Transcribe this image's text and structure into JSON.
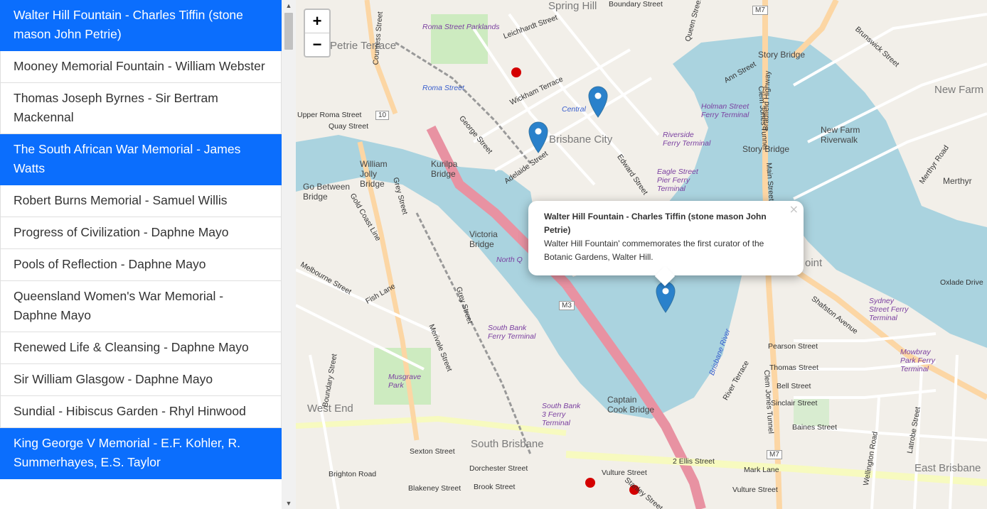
{
  "list": [
    {
      "label": "Walter Hill Fountain - Charles Tiffin (stone mason John Petrie)",
      "active": true
    },
    {
      "label": "Mooney Memorial Fountain - William Webster",
      "active": false
    },
    {
      "label": "Thomas Joseph Byrnes - Sir Bertram Mackennal",
      "active": false
    },
    {
      "label": "The South African War Memorial - James Watts",
      "active": true
    },
    {
      "label": "Robert Burns Memorial - Samuel Willis",
      "active": false
    },
    {
      "label": "Progress of Civilization - Daphne Mayo",
      "active": false
    },
    {
      "label": "Pools of Reflection - Daphne Mayo",
      "active": false
    },
    {
      "label": "Queensland Women's War Memorial - Daphne Mayo",
      "active": false
    },
    {
      "label": "Renewed Life & Cleansing - Daphne Mayo",
      "active": false
    },
    {
      "label": "Sir William Glasgow - Daphne Mayo",
      "active": false
    },
    {
      "label": "Sundial - Hibiscus Garden - Rhyl Hinwood",
      "active": false
    },
    {
      "label": "King George V Memorial - E.F. Kohler, R. Summerhayes, E.S. Taylor",
      "active": true
    }
  ],
  "scrollbar": {
    "up_icon": "▲",
    "down_icon": "▼"
  },
  "map": {
    "zoom_in": "+",
    "zoom_out": "−",
    "popup": {
      "title": "Walter Hill Fountain - Charles Tiffin (stone mason John Petrie)",
      "description": "Walter Hill Fountain' commemorates the first curator of the Botanic Gardens, Walter Hill.",
      "close": "×"
    },
    "labels": {
      "spring_hill": "Spring Hill",
      "boundary_st": "Boundary Street",
      "roma_parklands": "Roma Street Parklands",
      "petrie_terrace": "Petrie Terrace",
      "roma_station": "Roma Street",
      "central": "Central",
      "brisbane_city": "Brisbane City",
      "story_bridge": "Story Bridge",
      "story_bridge2": "Story Bridge",
      "new_farm": "New Farm",
      "new_farm_riverwalk": "New Farm Riverwalk",
      "holman_ferry": "Holman Street Ferry Terminal",
      "riverside_ferry": "Riverside Ferry Terminal",
      "eagle_st": "Eagle Street Pier Ferry Terminal",
      "william_jolly": "William Jolly Bridge",
      "kurilpa": "Kurilpa Bridge",
      "go_between": "Go Between Bridge",
      "victoria_bridge": "Victoria Bridge",
      "north_quay": "North Q",
      "south_bank_1": "South Bank Ferry Terminal",
      "south_bank_3": "South Bank 3 Ferry Terminal",
      "sydney_st": "Sydney Street Ferry Terminal",
      "mowbray": "Mowbray Park Ferry Terminal",
      "musgrave": "Musgrave Park",
      "west_end": "West End",
      "south_brisbane": "South Brisbane",
      "captain_cook": "Captain Cook Bridge",
      "east_brisbane": "East Brisbane",
      "brisbane_river": "Brisbane River",
      "shafston": "Shafston Avenue",
      "vulture_st": "Vulture Street",
      "vulture_st2": "Vulture Street",
      "merivale": "Merivale Street",
      "grey_st": "Grey Street",
      "grey_st2": "Grey Street",
      "george_st": "George Street",
      "adelaide_st": "Adelaide Street",
      "queen_st": "Queen Street",
      "edward_st": "Edward Street",
      "ann_st": "Ann Street",
      "wickham_tce": "Wickham Terrace",
      "leichhardt_st": "Leichhardt Street",
      "countess_st": "Countess Street",
      "brunswick_st": "Brunswick Street",
      "bradfield_hwy": "Bradfield Highway",
      "clem_jones_tunnel": "Clem Jones Tunnel",
      "clem_jones_tunnel2": "Clem Jones Tunnel",
      "main_st": "Main Street",
      "river_tce": "River Terrace",
      "wellington_rd": "Wellington Road",
      "latrobe_st": "Latrobe Street",
      "boundary_st2": "Boundary Street",
      "fish_lane": "Fish Lane",
      "melbourne_st": "Melbourne Street",
      "m3": "M3",
      "m7": "M7",
      "m7b": "M7",
      "route_10": "10",
      "gold_coast_line": "Gold Coast Line",
      "pearson_st": "Pearson Street",
      "thomas_st": "Thomas Street",
      "bell_st": "Bell Street",
      "sinclair_st": "Sinclair Street",
      "baines_st": "Baines Street",
      "mark_lane": "Mark Lane",
      "ellis_st": "2 Ellis Street",
      "sexton_st": "Sexton Street",
      "dorchester_st": "Dorchester Street",
      "brighton_rd": "Brighton Road",
      "brook_st": "Brook Street",
      "blakeney_st": "Blakeney Street",
      "stanley_st": "Stanley Street",
      "quay_st": "Quay Street",
      "upper_roma_st": "Upper Roma Street",
      "oxlade_dr": "Oxlade Drive",
      "merthyr_rd": "Merthyr Road",
      "merthyr": "Merthyr",
      "point": "oint"
    }
  }
}
